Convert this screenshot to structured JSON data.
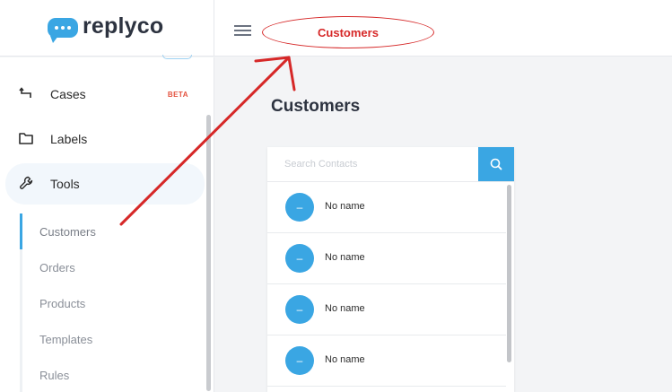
{
  "brand": {
    "name": "replyco"
  },
  "header": {
    "annotation_label": "Customers"
  },
  "sidebar": {
    "items": [
      {
        "label": "Cases",
        "badge": "BETA",
        "icon": "return-icon"
      },
      {
        "label": "Labels",
        "icon": "folder-icon"
      },
      {
        "label": "Tools",
        "icon": "wrench-icon"
      }
    ],
    "subitems": [
      {
        "label": "Customers"
      },
      {
        "label": "Orders"
      },
      {
        "label": "Products"
      },
      {
        "label": "Templates"
      },
      {
        "label": "Rules"
      }
    ]
  },
  "main": {
    "title": "Customers",
    "search": {
      "placeholder": "Search Contacts",
      "value": ""
    },
    "contacts": [
      {
        "initials": "–",
        "name": "No name"
      },
      {
        "initials": "–",
        "name": "No name"
      },
      {
        "initials": "–",
        "name": "No name"
      },
      {
        "initials": "–",
        "name": "No name"
      }
    ]
  },
  "colors": {
    "accent": "#3aa6e3",
    "annotation": "#d62828",
    "badge": "#e4523f"
  }
}
